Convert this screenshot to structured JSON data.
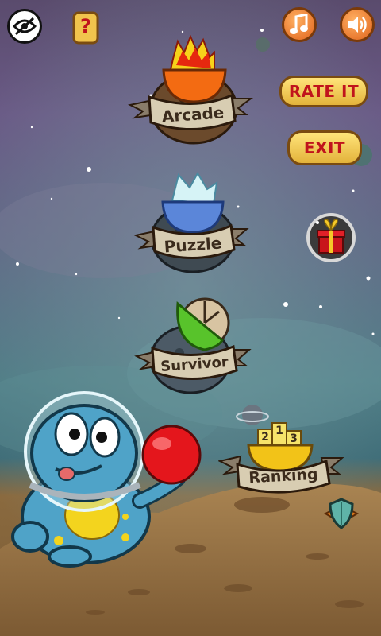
{
  "top_bar": {
    "hide_icon": "eye-off-icon",
    "help_icon": "question-scroll-icon",
    "help_symbol": "?",
    "music_icon": "music-note-icon",
    "sound_icon": "speaker-icon"
  },
  "menu": {
    "arcade_label": "Arcade",
    "puzzle_label": "Puzzle",
    "survivor_label": "Survivor",
    "ranking_label": "Ranking",
    "podium": [
      "2",
      "1",
      "3"
    ]
  },
  "buttons": {
    "rate_label": "RATE IT",
    "exit_label": "EXIT"
  },
  "extras": {
    "gift_icon": "gift-icon",
    "badge_icon": "shield-badge-icon"
  },
  "colors": {
    "button_text": "#c0141c",
    "button_fill": "#f3cc55",
    "fire_bowl": "#f36b12",
    "ice_bowl": "#5b86d9",
    "survivor_green": "#58c32b",
    "ranking_gold": "#f2c318"
  }
}
